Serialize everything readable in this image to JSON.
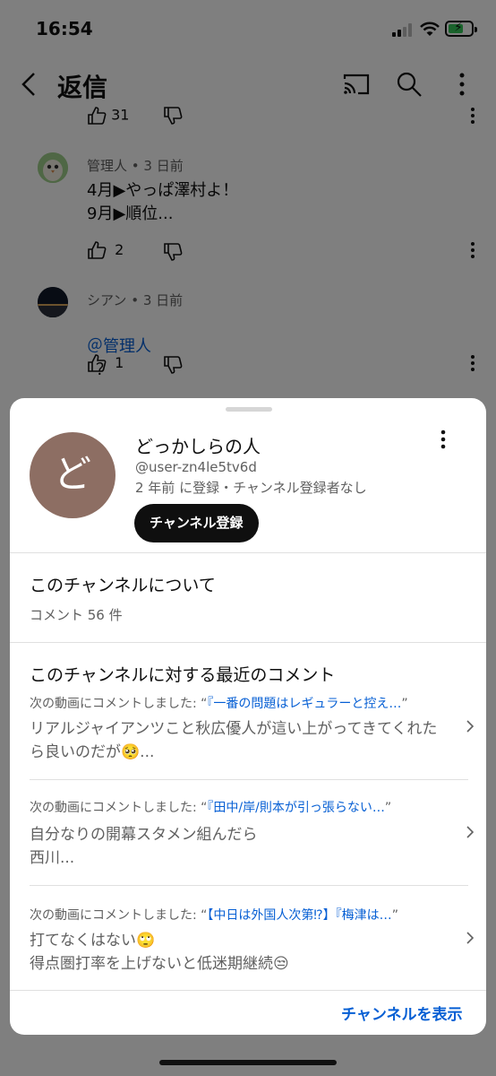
{
  "status": {
    "time": "16:54"
  },
  "appbar": {
    "title": "返信"
  },
  "comments": [
    {
      "likes": "31"
    },
    {
      "author": "管理人",
      "time": "3 日前",
      "text": "4月▶やっぱ澤村よ！\n9月▶順位...",
      "likes": "2"
    },
    {
      "author": "シアン",
      "time": "3 日前",
      "mention": "＠管理人",
      "text": "？",
      "likes": "1"
    }
  ],
  "sheet": {
    "avatar_letter": "ど",
    "channel_name": "どっかしらの人",
    "handle": "@user-zn4le5tv6d",
    "info": "2 年前 に登録・チャンネル登録者なし",
    "subscribe_label": "チャンネル登録",
    "about_title": "このチャンネルについて",
    "comment_count": "コメント 56 件",
    "recent_title": "このチャンネルに対する最近のコメント",
    "recent": [
      {
        "prefix": "次の動画にコメントしました: “",
        "video": "『一番の問題はレギュラーと控え…",
        "suffix": "”",
        "text": "リアルジャイアンツこと秋広優人が這い上がってきてくれたら良いのだが🥺..."
      },
      {
        "prefix": "次の動画にコメントしました: “",
        "video": "『田中/岸/則本が引っ張らない…",
        "suffix": "”",
        "text": "自分なりの開幕スタメン組んだら\n西川..."
      },
      {
        "prefix": "次の動画にコメントしました: “",
        "video": "【中日は外国人次第⁉】『梅津は…",
        "suffix": "”",
        "text": "打てなくはない🙄\n得点圏打率を上げないと低迷期継続😒"
      }
    ],
    "view_channel_label": "チャンネルを表示"
  },
  "colors": {
    "accent": "#065fd4",
    "avatar": "#8d6e63"
  }
}
